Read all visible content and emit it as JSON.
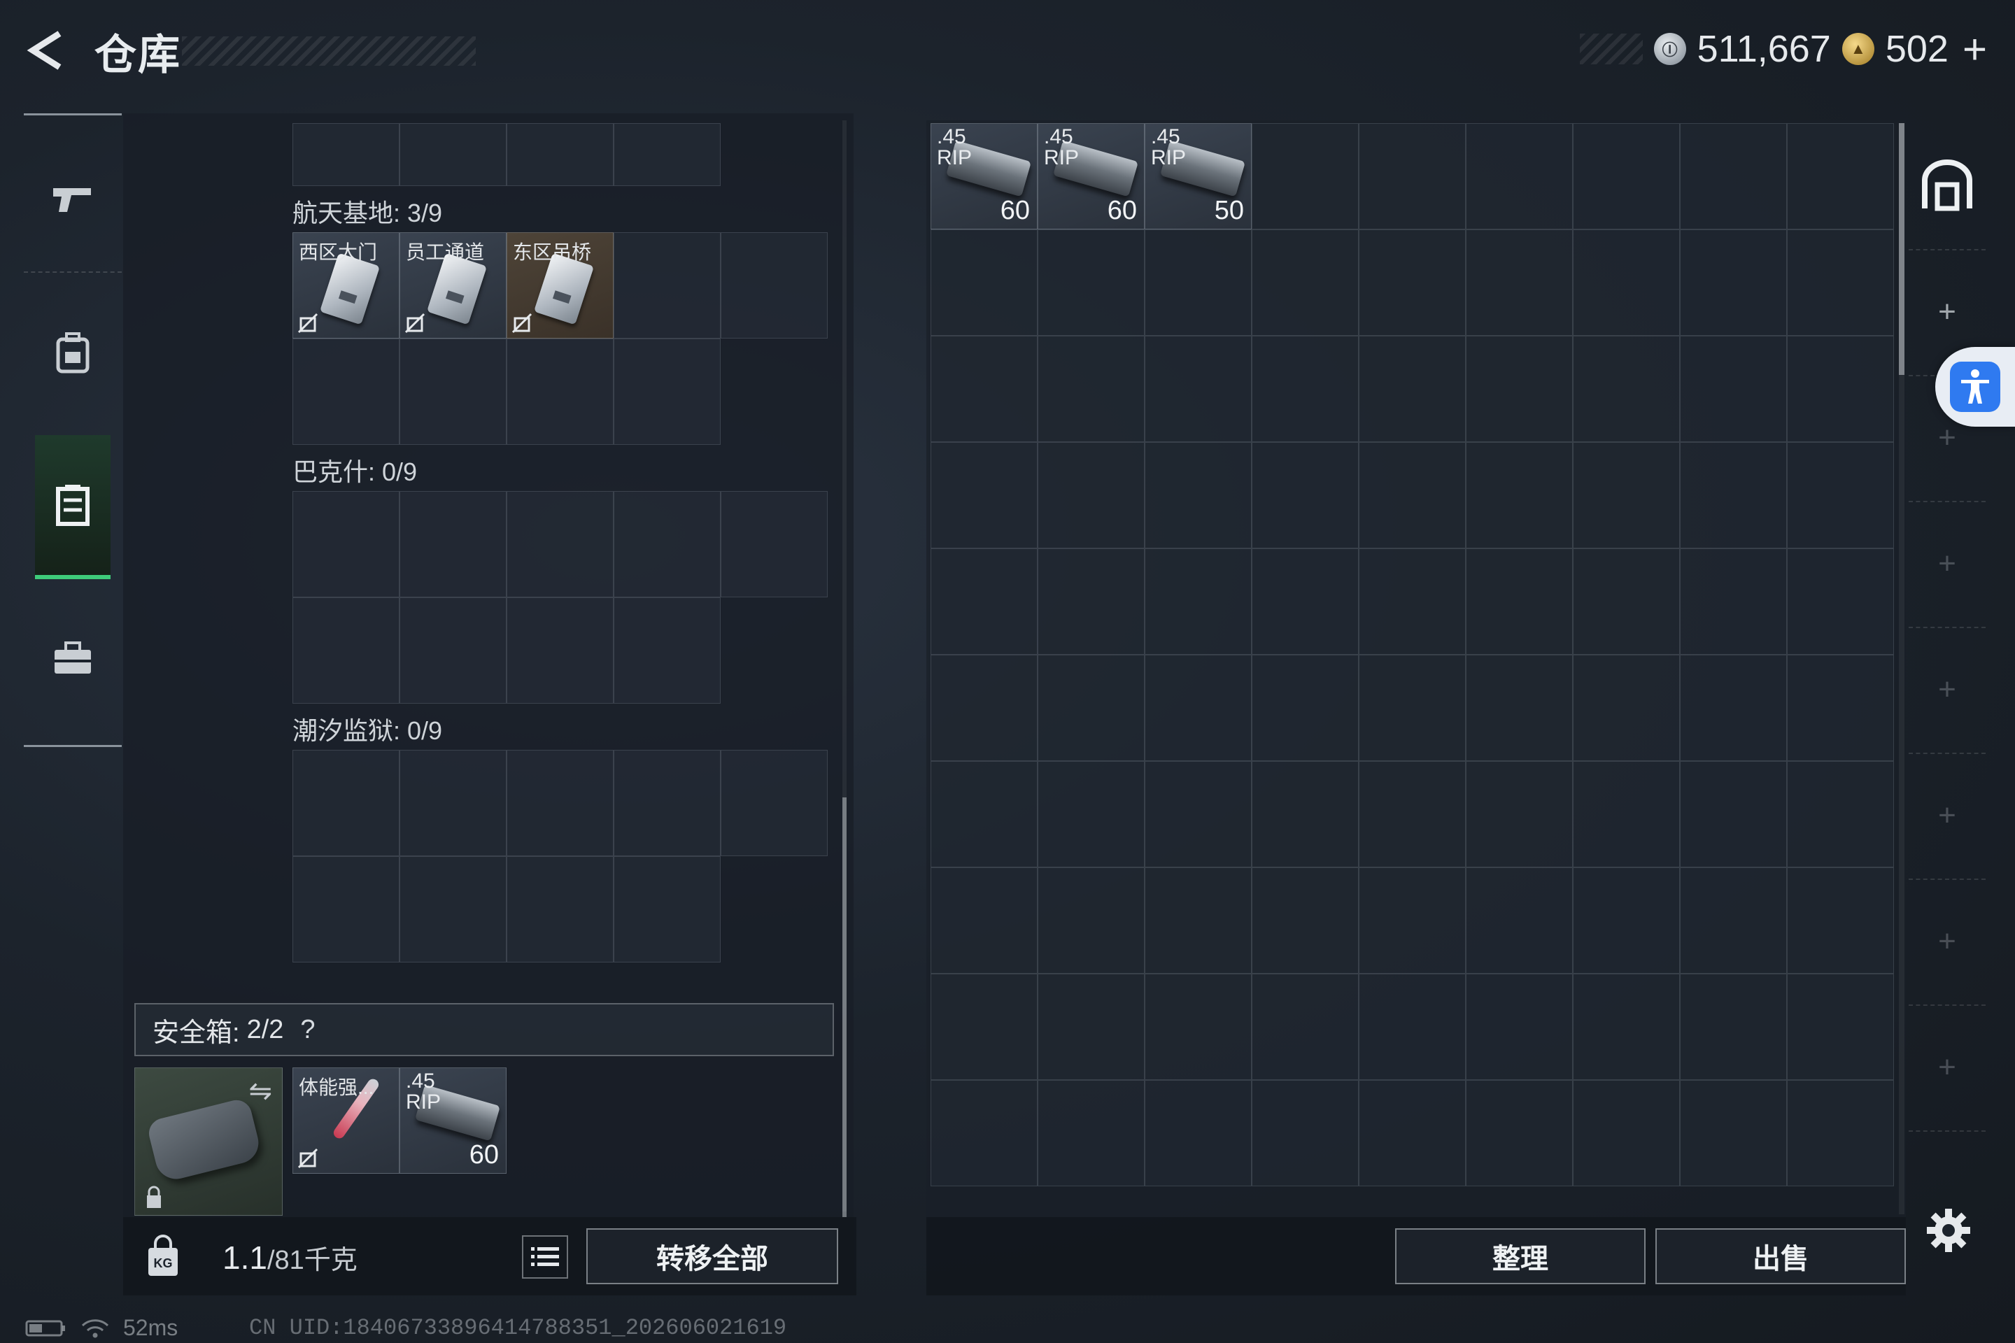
{
  "header": {
    "title": "仓库",
    "silver_amount": "511,667",
    "gold_amount": "502",
    "plus_label": "+"
  },
  "nav": {
    "items": [
      {
        "name": "weapons",
        "icon": "pistol-icon"
      },
      {
        "name": "backpack",
        "icon": "backpack-icon"
      },
      {
        "name": "storage",
        "icon": "container-icon",
        "active": true
      },
      {
        "name": "toolbox",
        "icon": "briefcase-icon"
      }
    ]
  },
  "left": {
    "sections": [
      {
        "label": "航天基地: 3/9"
      },
      {
        "label": "巴克什: 0/9"
      },
      {
        "label": "潮汐监狱: 0/9"
      }
    ],
    "keycards": [
      {
        "name": "西区大门",
        "warm": false
      },
      {
        "name": "员工通道",
        "warm": false
      },
      {
        "name": "东区吊桥",
        "warm": true
      }
    ],
    "safe_box": {
      "label": "安全箱:",
      "count": "2/2",
      "help": "?"
    },
    "safe_items": [
      {
        "name": "体能强..."
      },
      {
        "caliber": ".45",
        "type": "RIP",
        "count": "60"
      }
    ],
    "weight": {
      "current": "1.1",
      "max": "/81千克"
    },
    "transfer_all_label": "转移全部"
  },
  "right": {
    "items": [
      {
        "caliber": ".45",
        "type": "RIP",
        "count": "60"
      },
      {
        "caliber": ".45",
        "type": "RIP",
        "count": "60"
      },
      {
        "caliber": ".45",
        "type": "RIP",
        "count": "50"
      }
    ],
    "sort_label": "整理",
    "sell_label": "出售"
  },
  "status": {
    "ping": "52ms",
    "uid": "CN UID:18406733896414788351_202606021619"
  },
  "colors": {
    "accent_green": "#3ecb7a",
    "accessibility_blue": "#2f7af0"
  }
}
